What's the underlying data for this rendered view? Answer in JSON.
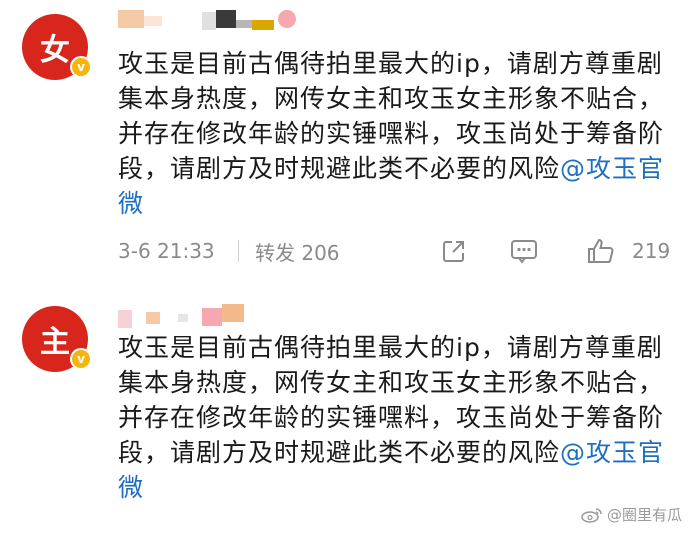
{
  "posts": [
    {
      "avatar_char": "女",
      "badge": "v",
      "content": "攻玉是目前古偶待拍里最大的ip，请剧方尊重剧集本身热度，网传女主和攻玉女主形象不贴合，并存在修改年龄的实锤嘿料，攻玉尚处于筹备阶段，请剧方及时规避此类不必要的风险",
      "mention": "@攻玉官微",
      "time": "3-6 21:33",
      "repost": "转发 206",
      "likes": "219",
      "icons": [
        "share-icon",
        "comment-icon",
        "like-icon"
      ]
    },
    {
      "avatar_char": "主",
      "badge": "v",
      "content": "攻玉是目前古偶待拍里最大的ip，请剧方尊重剧集本身热度，网传女主和攻玉女主形象不贴合，并存在修改年龄的实锤嘿料，攻玉尚处于筹备阶段，请剧方及时规避此类不必要的风险",
      "mention": "@攻玉官微"
    }
  ],
  "watermark": "@圈里有瓜",
  "colors": {
    "avatar": "#d8261c",
    "badge": "#f5b50a",
    "mention": "#1d6fc2",
    "meta": "#8a8a8a"
  }
}
